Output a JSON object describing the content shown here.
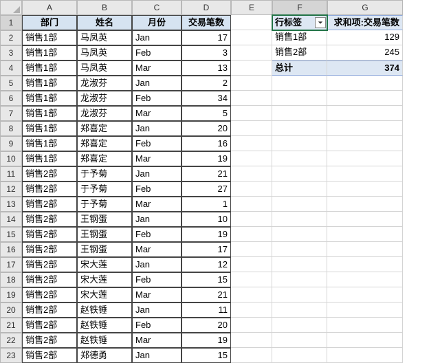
{
  "columns": [
    "A",
    "B",
    "C",
    "D",
    "E",
    "F",
    "G"
  ],
  "rowCount": 23,
  "activeCell": "F1",
  "table": {
    "headers": [
      "部门",
      "姓名",
      "月份",
      "交易笔数"
    ],
    "rows": [
      [
        "销售1部",
        "马凤英",
        "Jan",
        "17"
      ],
      [
        "销售1部",
        "马凤英",
        "Feb",
        "3"
      ],
      [
        "销售1部",
        "马凤英",
        "Mar",
        "13"
      ],
      [
        "销售1部",
        "龙淑芬",
        "Jan",
        "2"
      ],
      [
        "销售1部",
        "龙淑芬",
        "Feb",
        "34"
      ],
      [
        "销售1部",
        "龙淑芬",
        "Mar",
        "5"
      ],
      [
        "销售1部",
        "郑喜定",
        "Jan",
        "20"
      ],
      [
        "销售1部",
        "郑喜定",
        "Feb",
        "16"
      ],
      [
        "销售1部",
        "郑喜定",
        "Mar",
        "19"
      ],
      [
        "销售2部",
        "于予菊",
        "Jan",
        "21"
      ],
      [
        "销售2部",
        "于予菊",
        "Feb",
        "27"
      ],
      [
        "销售2部",
        "于予菊",
        "Mar",
        "1"
      ],
      [
        "销售2部",
        "王钢蛋",
        "Jan",
        "10"
      ],
      [
        "销售2部",
        "王钢蛋",
        "Feb",
        "19"
      ],
      [
        "销售2部",
        "王钢蛋",
        "Mar",
        "17"
      ],
      [
        "销售2部",
        "宋大莲",
        "Jan",
        "12"
      ],
      [
        "销售2部",
        "宋大莲",
        "Feb",
        "15"
      ],
      [
        "销售2部",
        "宋大莲",
        "Mar",
        "21"
      ],
      [
        "销售2部",
        "赵铁锤",
        "Jan",
        "11"
      ],
      [
        "销售2部",
        "赵铁锤",
        "Feb",
        "20"
      ],
      [
        "销售2部",
        "赵铁锤",
        "Mar",
        "19"
      ],
      [
        "销售2部",
        "郑德勇",
        "Jan",
        "15"
      ]
    ]
  },
  "pivot": {
    "rowLabelHeader": "行标签",
    "valueHeader": "求和项:交易笔数",
    "rows": [
      {
        "label": "销售1部",
        "value": "129"
      },
      {
        "label": "销售2部",
        "value": "245"
      }
    ],
    "totalLabel": "总计",
    "totalValue": "374"
  },
  "chart_data": {
    "type": "table",
    "title": "求和项:交易笔数 by 部门",
    "categories": [
      "销售1部",
      "销售2部"
    ],
    "values": [
      129,
      245
    ],
    "total": 374
  }
}
